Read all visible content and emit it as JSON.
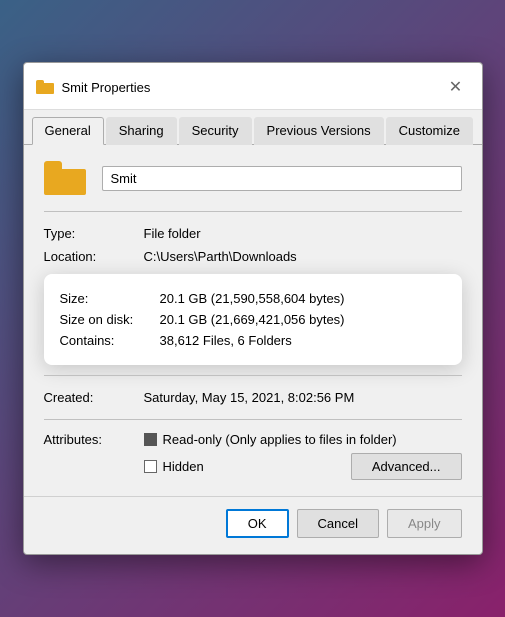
{
  "dialog": {
    "title": "Smit Properties",
    "close_label": "✕"
  },
  "tabs": {
    "items": [
      {
        "label": "General",
        "active": true
      },
      {
        "label": "Sharing",
        "active": false
      },
      {
        "label": "Security",
        "active": false
      },
      {
        "label": "Previous Versions",
        "active": false
      },
      {
        "label": "Customize",
        "active": false
      }
    ]
  },
  "folder": {
    "name_value": "Smit"
  },
  "info": {
    "type_label": "Type:",
    "type_value": "File folder",
    "location_label": "Location:",
    "location_value": "C:\\Users\\Parth\\Downloads"
  },
  "tooltip": {
    "size_label": "Size:",
    "size_value": "20.1 GB (21,590,558,604 bytes)",
    "size_on_disk_label": "Size on disk:",
    "size_on_disk_value": "20.1 GB (21,669,421,056 bytes)",
    "contains_label": "Contains:",
    "contains_value": "38,612 Files, 6 Folders"
  },
  "created": {
    "label": "Created:",
    "value": "Saturday, May 15, 2021, 8:02:56 PM"
  },
  "attributes": {
    "label": "Attributes:",
    "readonly_label": "Read-only (Only applies to files in folder)",
    "hidden_label": "Hidden",
    "advanced_label": "Advanced..."
  },
  "footer": {
    "ok_label": "OK",
    "cancel_label": "Cancel",
    "apply_label": "Apply"
  }
}
